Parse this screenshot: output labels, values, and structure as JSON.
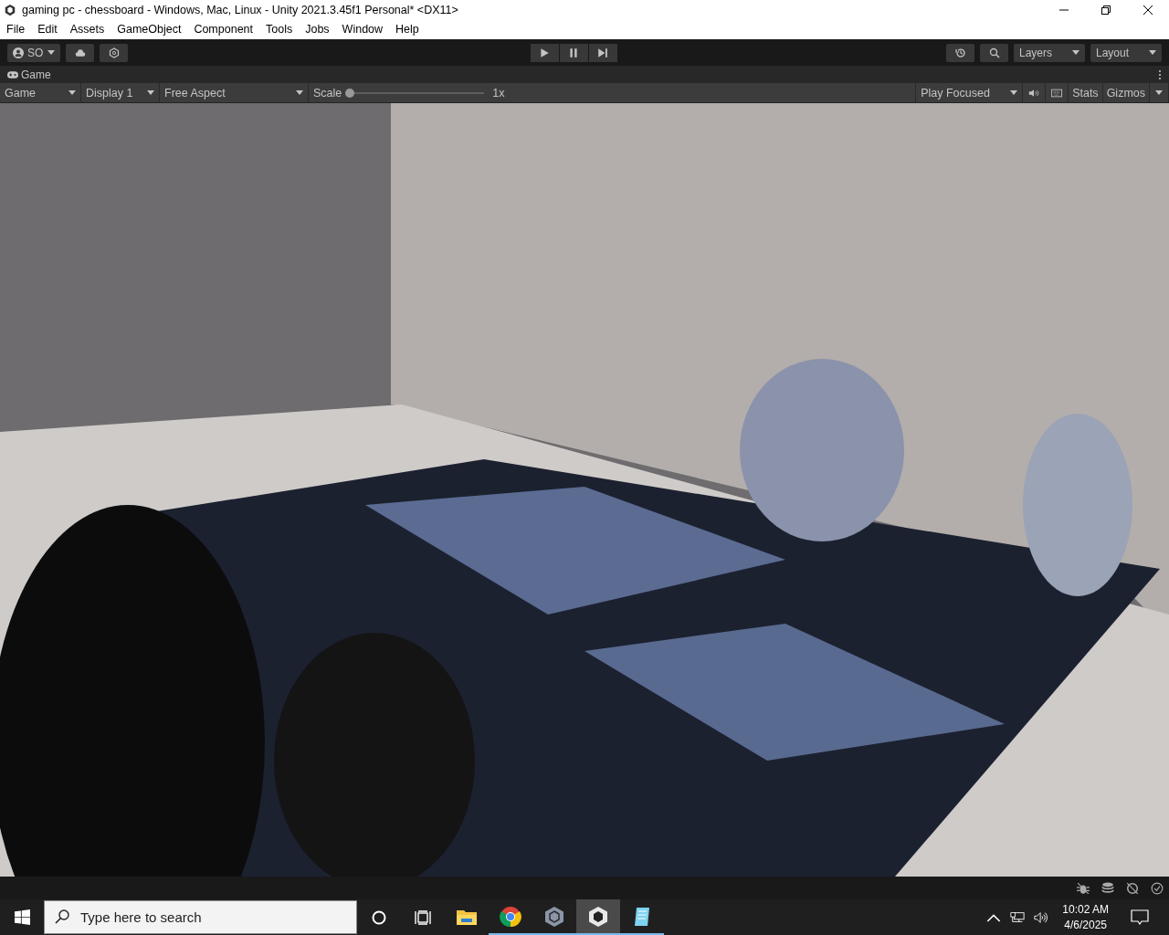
{
  "window": {
    "title": "gaming pc - chessboard - Windows, Mac, Linux - Unity 2021.3.45f1 Personal* <DX11>"
  },
  "menu": [
    "File",
    "Edit",
    "Assets",
    "GameObject",
    "Component",
    "Tools",
    "Jobs",
    "Window",
    "Help"
  ],
  "toolbar": {
    "account": "SO",
    "layers": "Layers",
    "layout": "Layout"
  },
  "game_tab": {
    "label": "Game"
  },
  "game_toolbar": {
    "view": "Game",
    "display": "Display 1",
    "aspect": "Free Aspect",
    "scale_label": "Scale",
    "scale": {
      "level": 0.0
    },
    "scale_value": "1x",
    "play_mode": "Play Focused",
    "stats": "Stats",
    "gizmos": "Gizmos"
  },
  "taskbar": {
    "search": {
      "placeholder": "Type here to search"
    },
    "apps": [
      {
        "kind": "folder",
        "running": false,
        "active": false
      },
      {
        "kind": "browser",
        "running": true,
        "active": false
      },
      {
        "kind": "hub",
        "running": true,
        "active": false
      },
      {
        "kind": "editor",
        "running": true,
        "active": true
      },
      {
        "kind": "notepad",
        "running": true,
        "active": false
      }
    ],
    "time": "10:02 AM",
    "date": "4/6/2025"
  }
}
